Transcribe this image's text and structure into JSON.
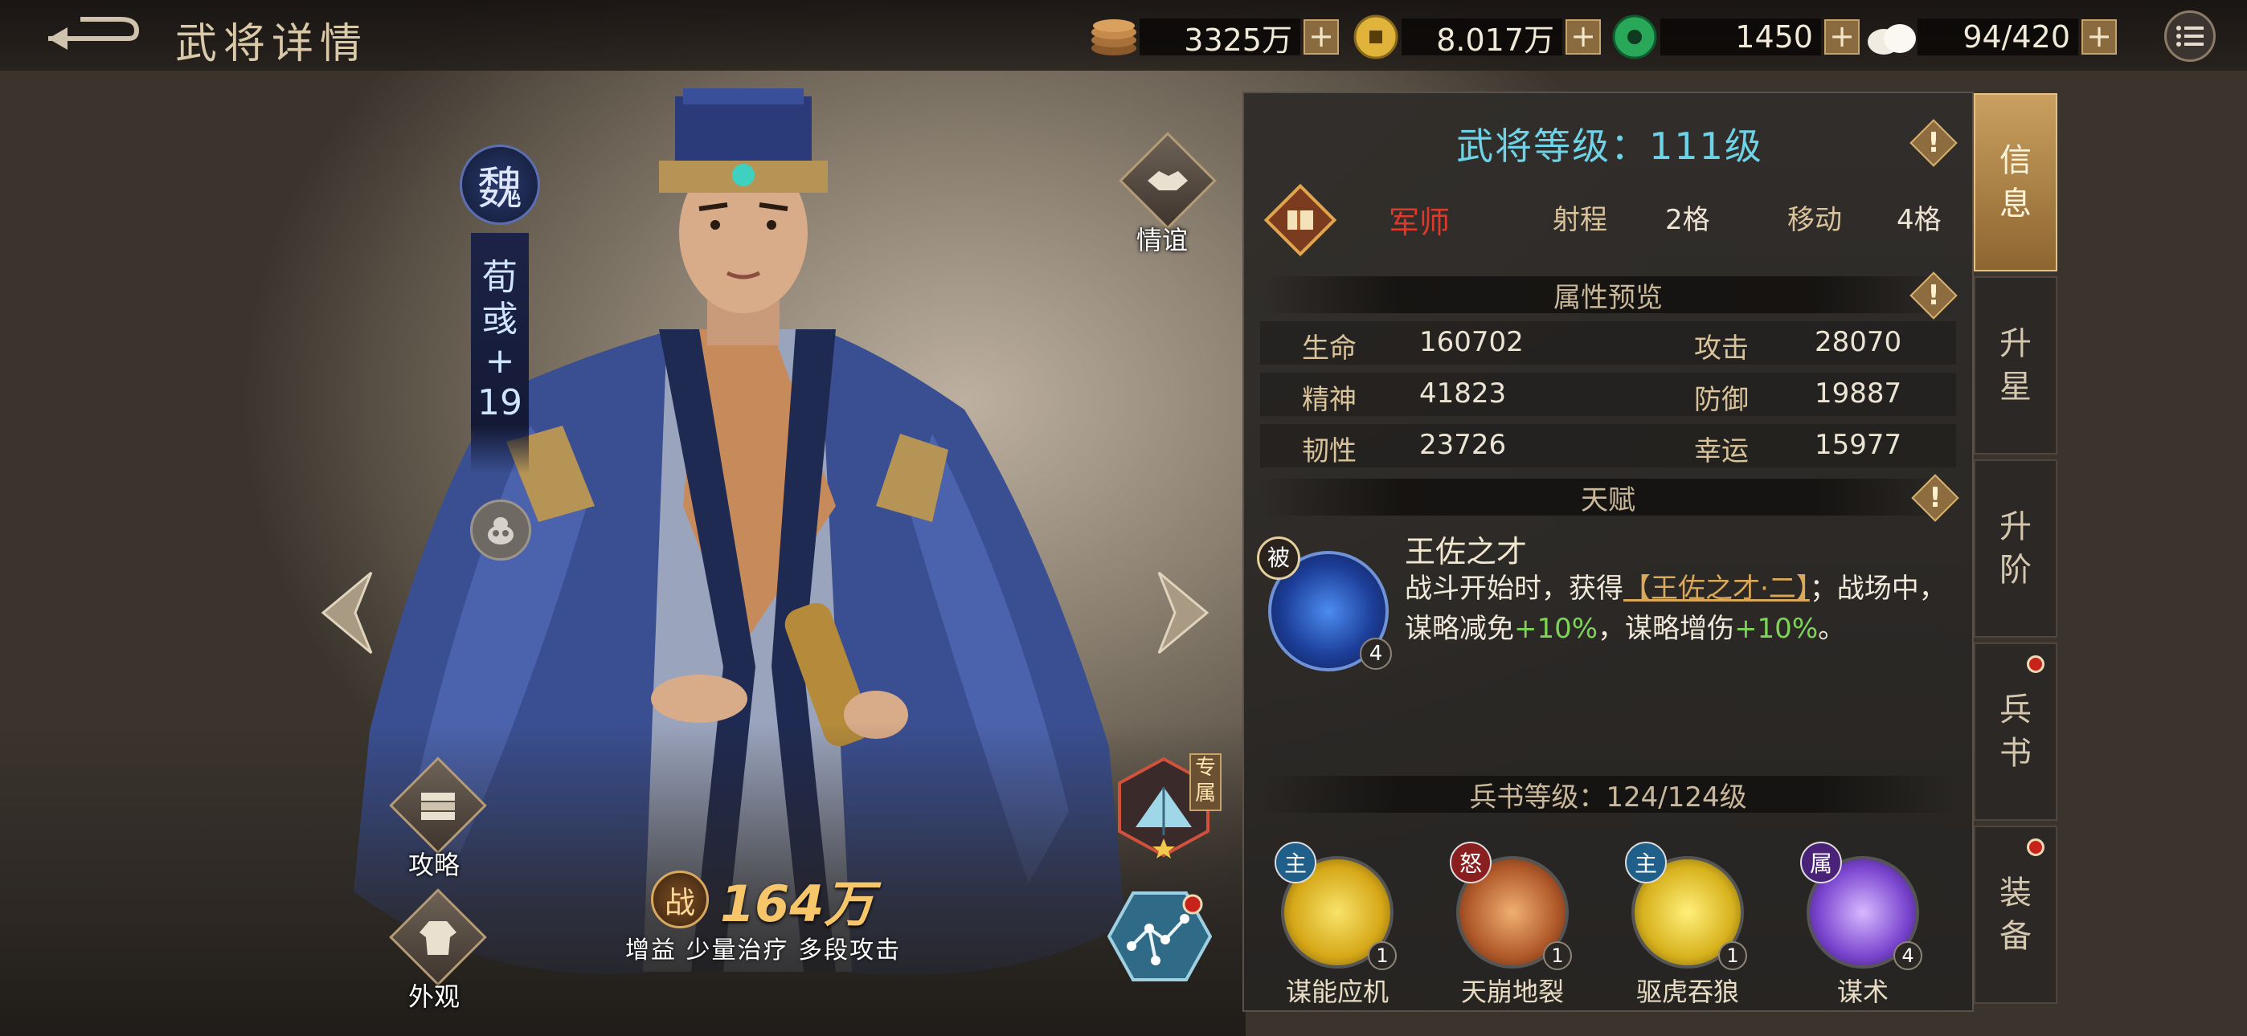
{
  "header": {
    "title": "武将详情",
    "resources": [
      {
        "icon": "copper-coins-icon",
        "value": "3325万"
      },
      {
        "icon": "gold-coin-icon",
        "value": "8.017万"
      },
      {
        "icon": "jade-icon",
        "value": "1450"
      },
      {
        "icon": "steamed-bun-icon",
        "value": "94/420"
      }
    ],
    "plus_label": "+"
  },
  "hero": {
    "faction": "魏",
    "name_chars": [
      "荀",
      "彧",
      "+",
      "19"
    ],
    "power_badge": "战",
    "power": "164万",
    "tags": "增益  少量治疗  多段攻击",
    "exclusive_tag": "专属"
  },
  "buttons": {
    "friendship": "情谊",
    "strategy": "攻略",
    "appearance": "外观"
  },
  "panel": {
    "level_title": "武将等级：111级",
    "info_glyph": "!",
    "class_name": "军师",
    "range_label": "射程",
    "range_value": "2格",
    "move_label": "移动",
    "move_value": "4格",
    "attr_header": "属性预览",
    "stats": [
      {
        "label": "生命",
        "value": "160702",
        "label2": "攻击",
        "value2": "28070"
      },
      {
        "label": "精神",
        "value": "41823",
        "label2": "防御",
        "value2": "19887"
      },
      {
        "label": "韧性",
        "value": "23726",
        "label2": "幸运",
        "value2": "15977"
      }
    ],
    "talent_header": "天赋",
    "talent": {
      "badge": "被",
      "level": "4",
      "name": "王佐之才",
      "desc_1": "战斗开始时，获得",
      "desc_hl": "【王佐之才·二】",
      "desc_2": "；战场中，谋略减免",
      "pct1": "+10%",
      "desc_3": "，谋略增伤",
      "pct2": "+10%",
      "desc_4": "。"
    },
    "book_header": "兵书等级：124/124级",
    "skills": [
      {
        "badge": "主",
        "name": "谋能应机",
        "level": "1",
        "color": "#e8c42a"
      },
      {
        "badge": "怒",
        "name": "天崩地裂",
        "level": "1",
        "color": "#c0672d"
      },
      {
        "badge": "主",
        "name": "驱虎吞狼",
        "level": "1",
        "color": "#e3c52f"
      },
      {
        "badge": "属",
        "name": "谋术",
        "level": "4",
        "color": "#8a55d8"
      }
    ]
  },
  "tabs": [
    {
      "label": [
        "信",
        "息"
      ],
      "active": true
    },
    {
      "label": [
        "升",
        "星"
      ]
    },
    {
      "label": [
        "升",
        "阶"
      ]
    },
    {
      "label": [
        "兵",
        "书"
      ],
      "dot": true
    },
    {
      "label": [
        "装",
        "备"
      ],
      "dot": true
    }
  ]
}
